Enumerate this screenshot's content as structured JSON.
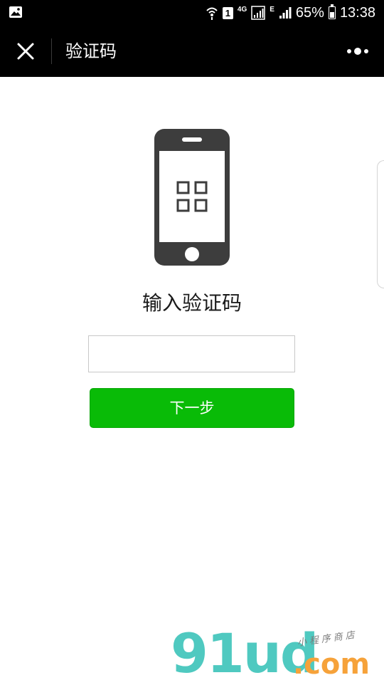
{
  "status_bar": {
    "network_type": "4G",
    "sim_slot": "1",
    "secondary_network": "E",
    "battery_percent": "65%",
    "battery_level": 0.65,
    "time": "13:38",
    "icons": [
      "image-icon",
      "wifi-calling-icon",
      "sim-icon",
      "signal-icon",
      "battery-icon"
    ]
  },
  "nav": {
    "title": "验证码",
    "close_icon": "close-icon",
    "more_icon": "more-icon"
  },
  "main": {
    "illustration_icon": "phone-grid-icon",
    "heading": "输入验证码",
    "code_input": {
      "value": "",
      "placeholder": ""
    },
    "next_button_label": "下一步"
  },
  "watermark": {
    "logo": "91ud",
    "suffix": ".com",
    "tagline": "小程序商店"
  },
  "colors": {
    "accent_green": "#09bb07",
    "nav_background": "#000000",
    "logo_teal": "#4fc9c0",
    "logo_orange": "#f6a23a"
  }
}
